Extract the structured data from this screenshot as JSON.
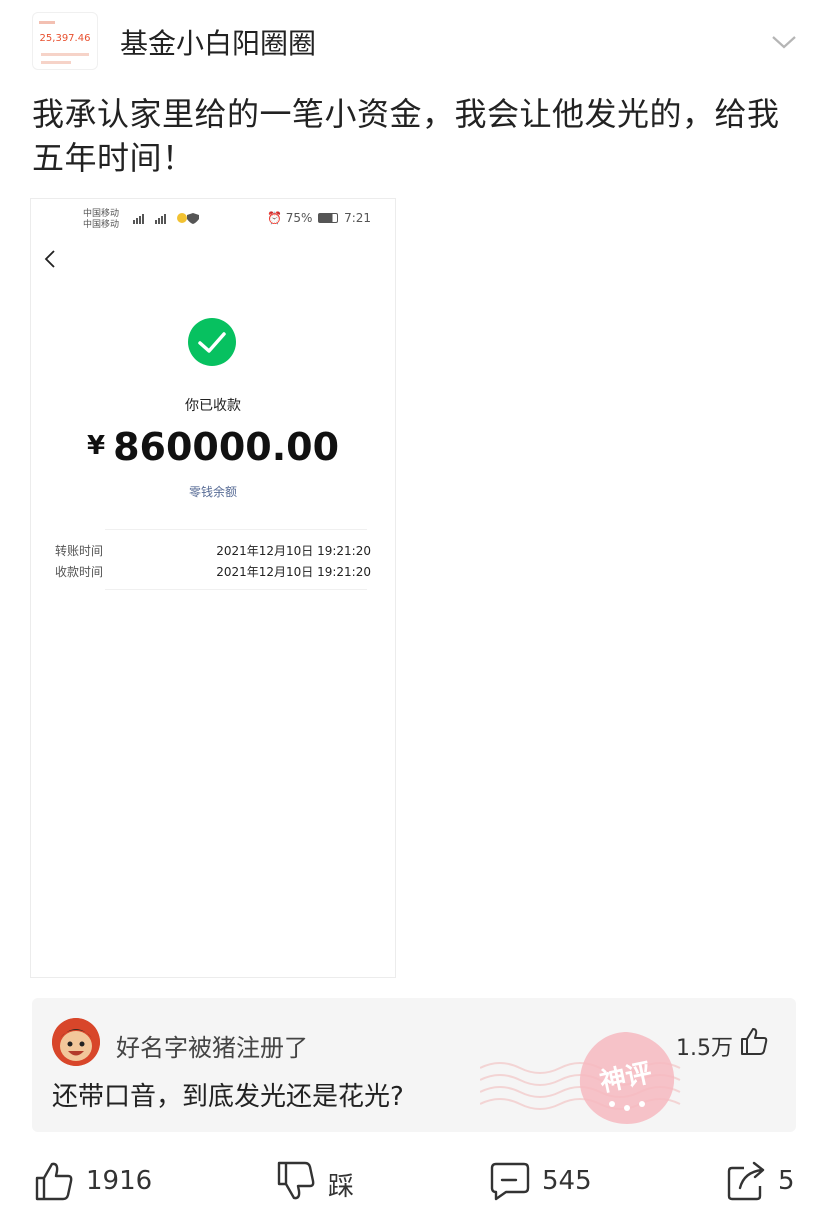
{
  "header": {
    "avatar_amount": "25,397.46",
    "author": "基金小白阳圈圈"
  },
  "post": {
    "text": "我承认家里给的一笔小资金，我会让他发光的，给我五年时间！"
  },
  "screenshot": {
    "carrier_1": "中国移动",
    "carrier_2": "中国移动",
    "battery": "75%",
    "time": "7:21",
    "received_label": "你已收款",
    "currency": "¥",
    "amount": "860000.00",
    "balance_link": "零钱余额",
    "rows": [
      {
        "label": "转账时间",
        "value": "2021年12月10日 19:21:20"
      },
      {
        "label": "收款时间",
        "value": "2021年12月10日 19:21:20"
      }
    ],
    "accent": "#07c160"
  },
  "comment": {
    "user": "好名字被猪注册了",
    "likes": "1.5万",
    "text": "还带口音，到底发光还是花光?",
    "stamp_text": "神评"
  },
  "actions": {
    "like_count": "1916",
    "dislike_label": "踩",
    "comment_count": "545",
    "share_count": "5"
  }
}
